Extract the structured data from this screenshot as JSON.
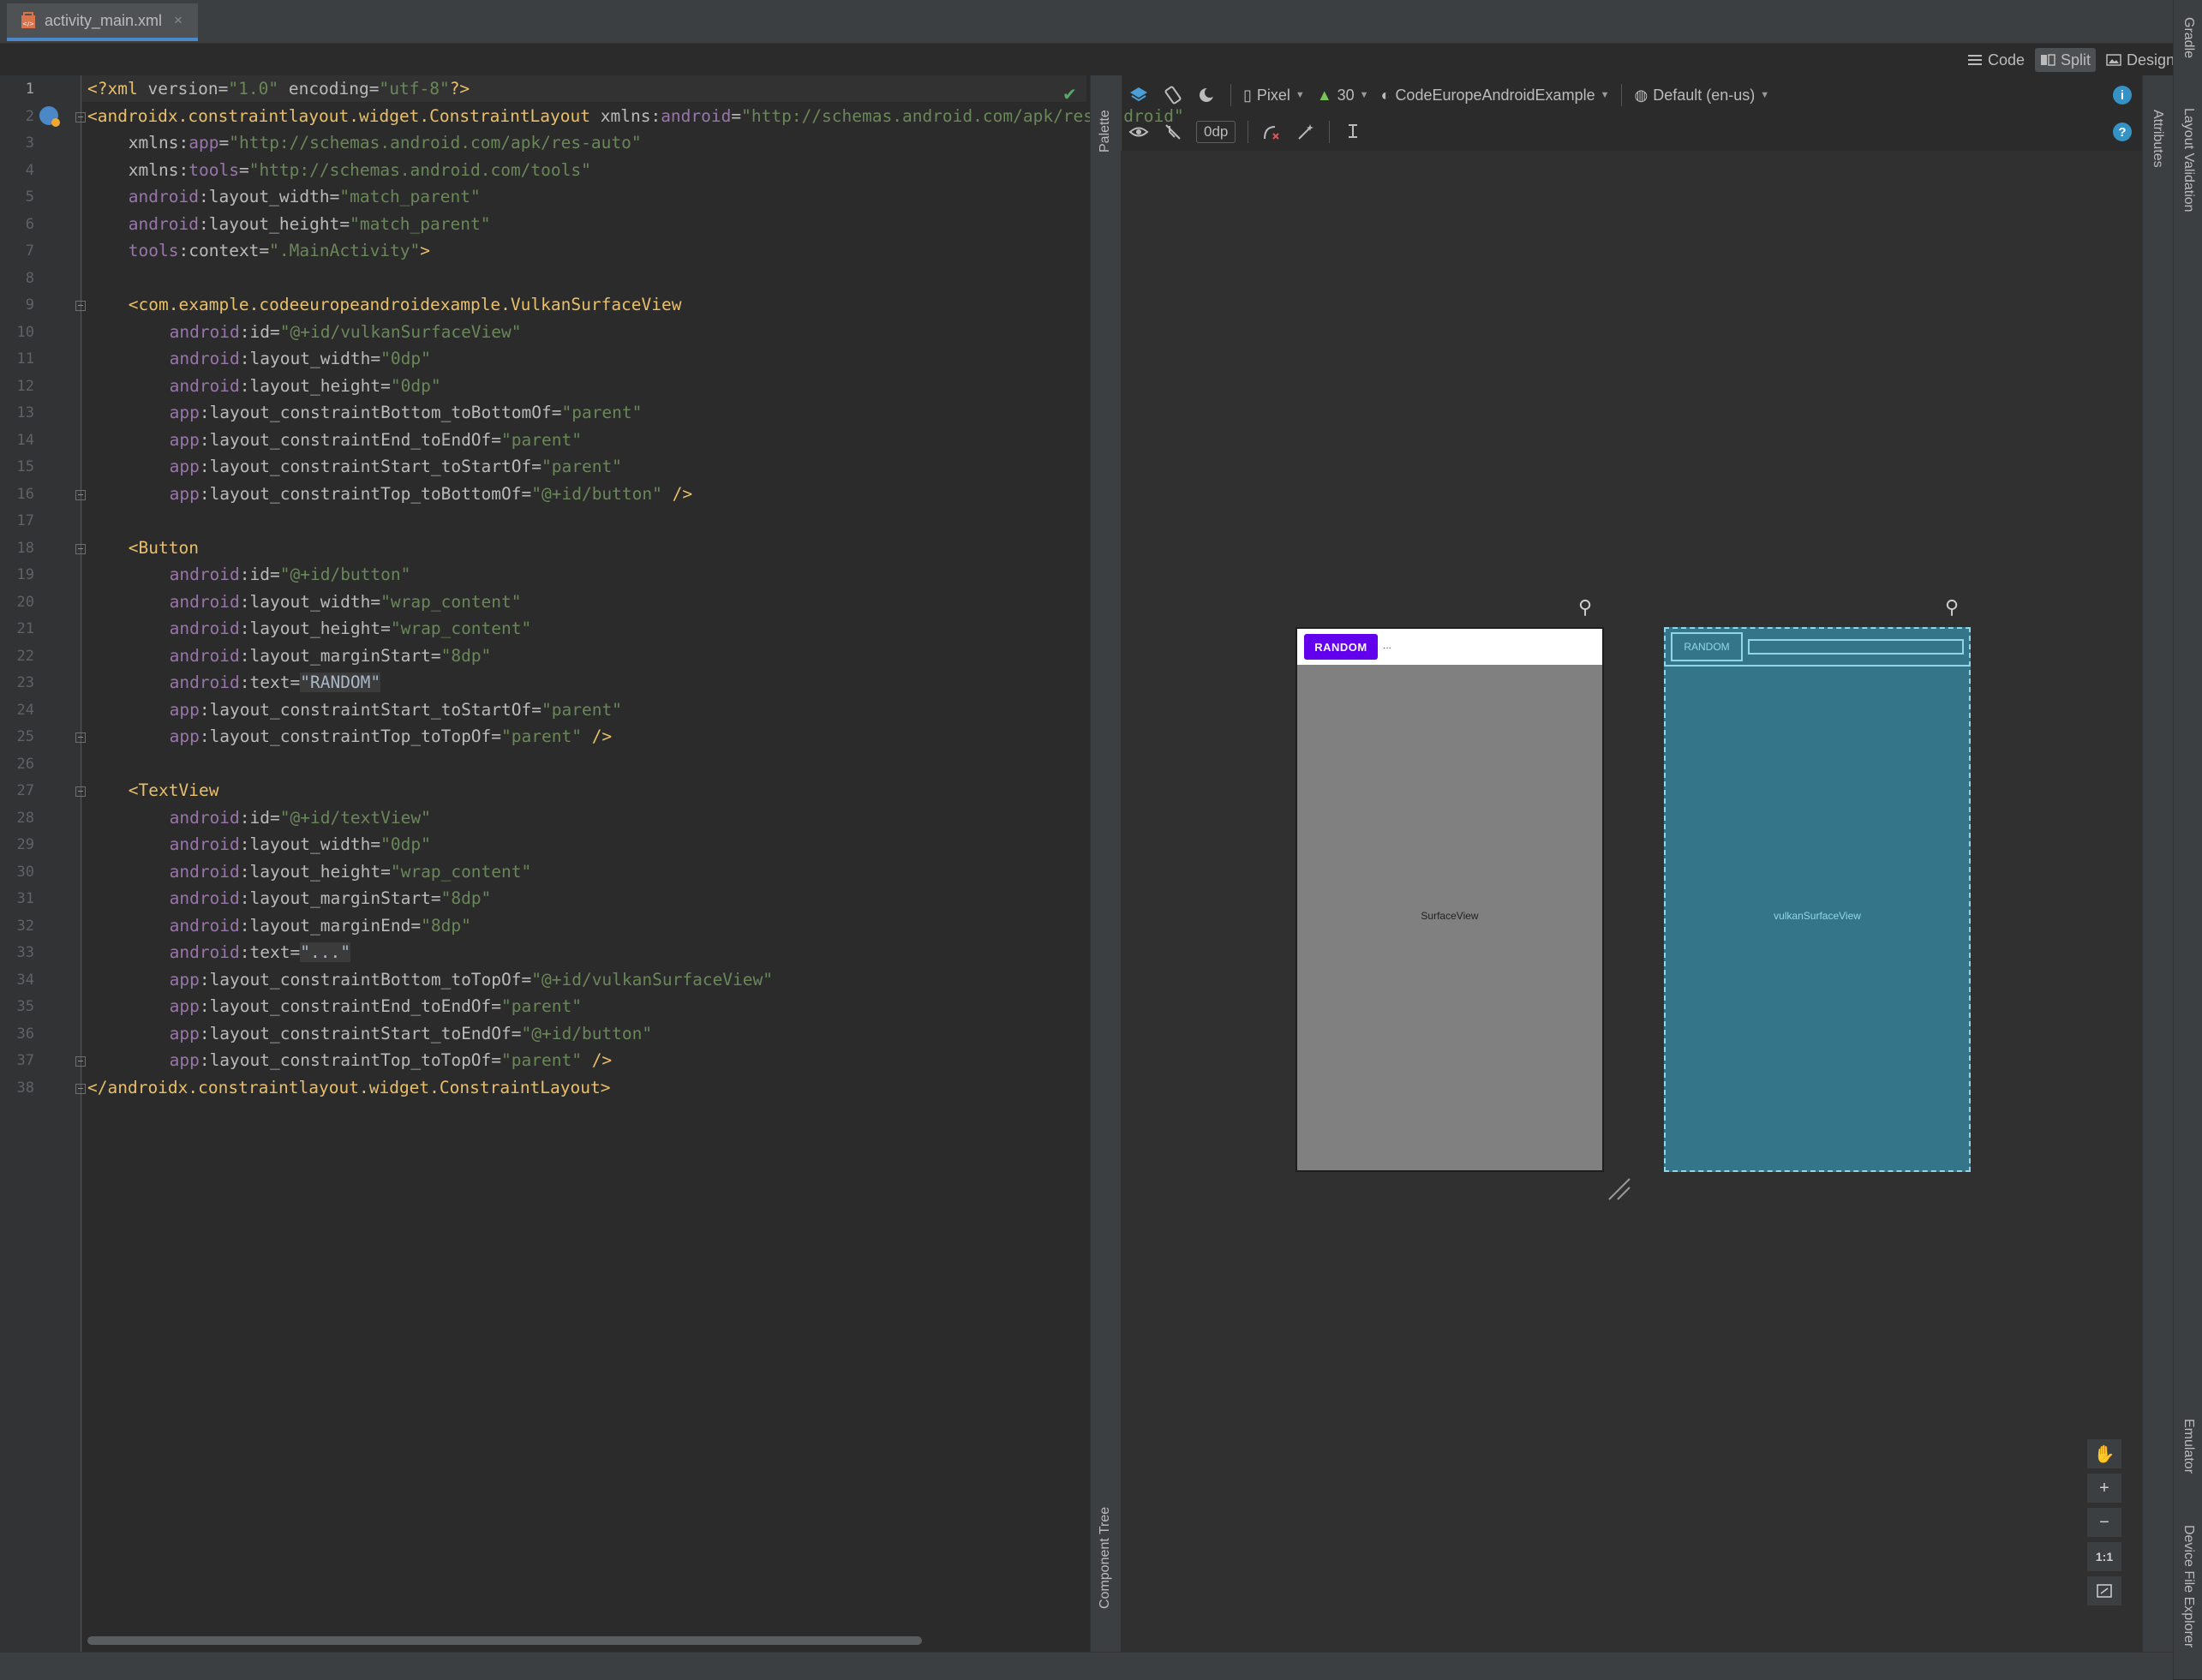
{
  "file_tab": {
    "name": "activity_main.xml",
    "close": "×"
  },
  "editor_modes": [
    {
      "label": "Code",
      "icon": "lines-icon"
    },
    {
      "label": "Split",
      "icon": "split-icon",
      "active": true
    },
    {
      "label": "Design",
      "icon": "image-icon"
    }
  ],
  "code_lines": [
    {
      "n": "1",
      "indent": 0,
      "parts": [
        [
          "pi",
          "<?"
        ],
        [
          "tag",
          "xml"
        ],
        [
          "at",
          " version="
        ],
        [
          "val",
          "\"1.0\""
        ],
        [
          "at",
          " encoding="
        ],
        [
          "val",
          "\"utf-8\""
        ],
        [
          "pi",
          "?>"
        ]
      ]
    },
    {
      "n": "2",
      "indent": 0,
      "fold": true,
      "parts": [
        [
          "tag",
          "<androidx.constraintlayout.widget.ConstraintLayout"
        ],
        [
          "at",
          " xmlns:"
        ],
        [
          "ns",
          "android"
        ],
        [
          "at",
          "="
        ],
        [
          "val",
          "\"http://schemas.android.com/apk/res/android\""
        ]
      ]
    },
    {
      "n": "3",
      "indent": 4,
      "parts": [
        [
          "at",
          "xmlns:"
        ],
        [
          "ns",
          "app"
        ],
        [
          "at",
          "="
        ],
        [
          "val",
          "\"http://schemas.android.com/apk/res-auto\""
        ]
      ]
    },
    {
      "n": "4",
      "indent": 4,
      "parts": [
        [
          "at",
          "xmlns:"
        ],
        [
          "ns",
          "tools"
        ],
        [
          "at",
          "="
        ],
        [
          "val",
          "\"http://schemas.android.com/tools\""
        ]
      ]
    },
    {
      "n": "5",
      "indent": 4,
      "parts": [
        [
          "ns",
          "android"
        ],
        [
          "at",
          ":layout_width="
        ],
        [
          "val",
          "\"match_parent\""
        ]
      ]
    },
    {
      "n": "6",
      "indent": 4,
      "parts": [
        [
          "ns",
          "android"
        ],
        [
          "at",
          ":layout_height="
        ],
        [
          "val",
          "\"match_parent\""
        ]
      ]
    },
    {
      "n": "7",
      "indent": 4,
      "parts": [
        [
          "ns",
          "tools"
        ],
        [
          "at",
          ":context="
        ],
        [
          "val",
          "\".MainActivity\""
        ],
        [
          "tag",
          ">"
        ]
      ]
    },
    {
      "n": "8",
      "indent": 0,
      "parts": []
    },
    {
      "n": "9",
      "indent": 4,
      "fold": true,
      "parts": [
        [
          "tag",
          "<com.example.codeeuropeandroidexample.VulkanSurfaceView"
        ]
      ]
    },
    {
      "n": "10",
      "indent": 8,
      "parts": [
        [
          "ns",
          "android"
        ],
        [
          "at",
          ":id="
        ],
        [
          "val",
          "\"@+id/vulkanSurfaceView\""
        ]
      ]
    },
    {
      "n": "11",
      "indent": 8,
      "parts": [
        [
          "ns",
          "android"
        ],
        [
          "at",
          ":layout_width="
        ],
        [
          "val",
          "\"0dp\""
        ]
      ]
    },
    {
      "n": "12",
      "indent": 8,
      "parts": [
        [
          "ns",
          "android"
        ],
        [
          "at",
          ":layout_height="
        ],
        [
          "val",
          "\"0dp\""
        ]
      ]
    },
    {
      "n": "13",
      "indent": 8,
      "parts": [
        [
          "ns",
          "app"
        ],
        [
          "at",
          ":layout_constraintBottom_toBottomOf="
        ],
        [
          "val",
          "\"parent\""
        ]
      ]
    },
    {
      "n": "14",
      "indent": 8,
      "parts": [
        [
          "ns",
          "app"
        ],
        [
          "at",
          ":layout_constraintEnd_toEndOf="
        ],
        [
          "val",
          "\"parent\""
        ]
      ]
    },
    {
      "n": "15",
      "indent": 8,
      "parts": [
        [
          "ns",
          "app"
        ],
        [
          "at",
          ":layout_constraintStart_toStartOf="
        ],
        [
          "val",
          "\"parent\""
        ]
      ]
    },
    {
      "n": "16",
      "indent": 8,
      "fold": true,
      "parts": [
        [
          "ns",
          "app"
        ],
        [
          "at",
          ":layout_constraintTop_toBottomOf="
        ],
        [
          "val",
          "\"@+id/button\""
        ],
        [
          "tag",
          " />"
        ]
      ]
    },
    {
      "n": "17",
      "indent": 0,
      "parts": []
    },
    {
      "n": "18",
      "indent": 4,
      "fold": true,
      "parts": [
        [
          "tag",
          "<Button"
        ]
      ]
    },
    {
      "n": "19",
      "indent": 8,
      "parts": [
        [
          "ns",
          "android"
        ],
        [
          "at",
          ":id="
        ],
        [
          "val",
          "\"@+id/button\""
        ]
      ]
    },
    {
      "n": "20",
      "indent": 8,
      "parts": [
        [
          "ns",
          "android"
        ],
        [
          "at",
          ":layout_width="
        ],
        [
          "val",
          "\"wrap_content\""
        ]
      ]
    },
    {
      "n": "21",
      "indent": 8,
      "parts": [
        [
          "ns",
          "android"
        ],
        [
          "at",
          ":layout_height="
        ],
        [
          "val",
          "\"wrap_content\""
        ]
      ]
    },
    {
      "n": "22",
      "indent": 8,
      "parts": [
        [
          "ns",
          "android"
        ],
        [
          "at",
          ":layout_marginStart="
        ],
        [
          "val",
          "\"8dp\""
        ]
      ]
    },
    {
      "n": "23",
      "indent": 8,
      "parts": [
        [
          "ns",
          "android"
        ],
        [
          "at",
          ":text="
        ],
        [
          "hl",
          "\"RANDOM\""
        ]
      ]
    },
    {
      "n": "24",
      "indent": 8,
      "parts": [
        [
          "ns",
          "app"
        ],
        [
          "at",
          ":layout_constraintStart_toStartOf="
        ],
        [
          "val",
          "\"parent\""
        ]
      ]
    },
    {
      "n": "25",
      "indent": 8,
      "fold": true,
      "parts": [
        [
          "ns",
          "app"
        ],
        [
          "at",
          ":layout_constraintTop_toTopOf="
        ],
        [
          "val",
          "\"parent\""
        ],
        [
          "tag",
          " />"
        ]
      ]
    },
    {
      "n": "26",
      "indent": 0,
      "parts": []
    },
    {
      "n": "27",
      "indent": 4,
      "fold": true,
      "parts": [
        [
          "tag",
          "<TextView"
        ]
      ]
    },
    {
      "n": "28",
      "indent": 8,
      "parts": [
        [
          "ns",
          "android"
        ],
        [
          "at",
          ":id="
        ],
        [
          "val",
          "\"@+id/textView\""
        ]
      ]
    },
    {
      "n": "29",
      "indent": 8,
      "parts": [
        [
          "ns",
          "android"
        ],
        [
          "at",
          ":layout_width="
        ],
        [
          "val",
          "\"0dp\""
        ]
      ]
    },
    {
      "n": "30",
      "indent": 8,
      "parts": [
        [
          "ns",
          "android"
        ],
        [
          "at",
          ":layout_height="
        ],
        [
          "val",
          "\"wrap_content\""
        ]
      ]
    },
    {
      "n": "31",
      "indent": 8,
      "parts": [
        [
          "ns",
          "android"
        ],
        [
          "at",
          ":layout_marginStart="
        ],
        [
          "val",
          "\"8dp\""
        ]
      ]
    },
    {
      "n": "32",
      "indent": 8,
      "parts": [
        [
          "ns",
          "android"
        ],
        [
          "at",
          ":layout_marginEnd="
        ],
        [
          "val",
          "\"8dp\""
        ]
      ]
    },
    {
      "n": "33",
      "indent": 8,
      "parts": [
        [
          "ns",
          "android"
        ],
        [
          "at",
          ":text="
        ],
        [
          "hl",
          "\"...\""
        ]
      ]
    },
    {
      "n": "34",
      "indent": 8,
      "parts": [
        [
          "ns",
          "app"
        ],
        [
          "at",
          ":layout_constraintBottom_toTopOf="
        ],
        [
          "val",
          "\"@+id/vulkanSurfaceView\""
        ]
      ]
    },
    {
      "n": "35",
      "indent": 8,
      "parts": [
        [
          "ns",
          "app"
        ],
        [
          "at",
          ":layout_constraintEnd_toEndOf="
        ],
        [
          "val",
          "\"parent\""
        ]
      ]
    },
    {
      "n": "36",
      "indent": 8,
      "parts": [
        [
          "ns",
          "app"
        ],
        [
          "at",
          ":layout_constraintStart_toEndOf="
        ],
        [
          "val",
          "\"@+id/button\""
        ]
      ]
    },
    {
      "n": "37",
      "indent": 8,
      "fold": true,
      "parts": [
        [
          "ns",
          "app"
        ],
        [
          "at",
          ":layout_constraintTop_toTopOf="
        ],
        [
          "val",
          "\"parent\""
        ],
        [
          "tag",
          " />"
        ]
      ]
    },
    {
      "n": "38",
      "indent": 0,
      "fold": true,
      "parts": [
        [
          "tag",
          "</androidx.constraintlayout.widget.ConstraintLayout>"
        ]
      ]
    }
  ],
  "side_panels": {
    "palette": "Palette",
    "component_tree": "Component Tree",
    "attributes": "Attributes",
    "layout_validation": "Layout Validation",
    "gradle": "Gradle",
    "emulator": "Emulator",
    "device_file_explorer": "Device File Explorer"
  },
  "design_toolbar": {
    "device": "Pixel",
    "api": "30",
    "theme": "CodeEuropeAndroidExample",
    "locale": "Default (en-us)",
    "default_margin": "0dp"
  },
  "preview": {
    "button_label": "RANDOM",
    "textview_text": "...",
    "surface_label": "SurfaceView"
  },
  "blueprint": {
    "button_label": "RANDOM",
    "surface_label": "vulkanSurfaceView"
  },
  "zoom_controls": {
    "pan": "✋",
    "zoom_in": "+",
    "zoom_out": "−",
    "actual_size": "1:1"
  },
  "colors": {
    "button_purple": "#6200ee",
    "blueprint_bg": "#35758a",
    "blueprint_line": "#8fd6ea",
    "tag_yellow": "#e8bf6a",
    "string_green": "#6a8759",
    "namespace_purple": "#9876aa"
  }
}
